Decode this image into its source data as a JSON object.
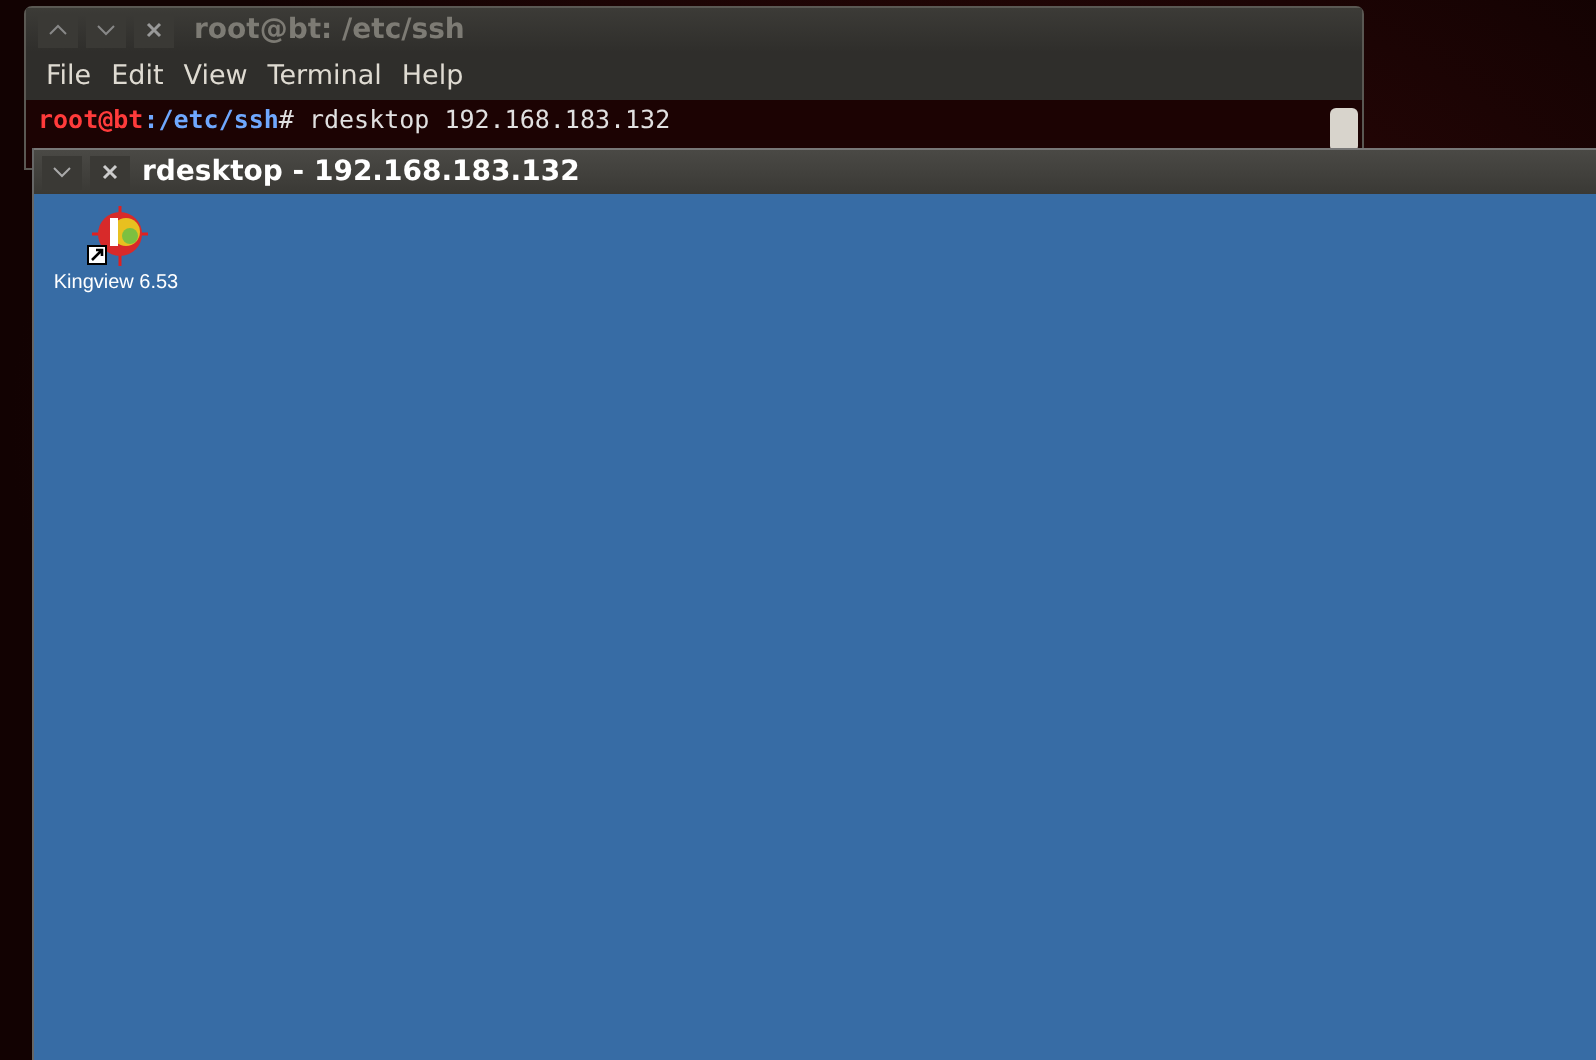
{
  "terminal": {
    "title": "root@bt: /etc/ssh",
    "menu": [
      "File",
      "Edit",
      "View",
      "Terminal",
      "Help"
    ],
    "prompt_user": "root@bt",
    "prompt_path": ":/etc/ssh",
    "prompt_mark": "#",
    "command": " rdesktop 192.168.183.132"
  },
  "rdesktop": {
    "title": "rdesktop - 192.168.183.132",
    "desktop_icons": [
      {
        "label": "Kingview 6.53"
      }
    ]
  }
}
